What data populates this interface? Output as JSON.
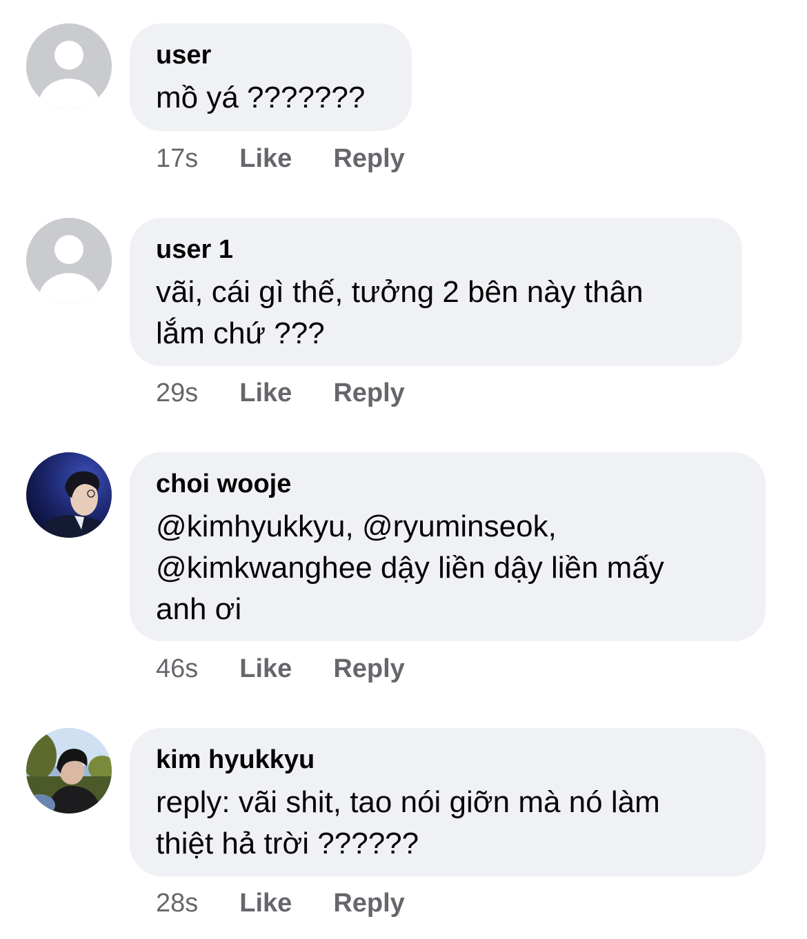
{
  "comments": [
    {
      "author": "user",
      "lines": [
        "mồ yá ???????"
      ],
      "time": "17s",
      "like": "Like",
      "reply": "Reply",
      "avatar": "default-avatar-icon"
    },
    {
      "author": "user 1",
      "lines": [
        "vãi, cái gì thế, tưởng 2 bên này thân",
        "lắm chứ ???"
      ],
      "time": "29s",
      "like": "Like",
      "reply": "Reply",
      "avatar": "default-avatar-icon"
    },
    {
      "author": "choi wooje",
      "lines": [
        "@kimhyukkyu, @ryuminseok,",
        "@kimkwanghee dậy liền dậy liền mấy",
        "anh ơi"
      ],
      "time": "46s",
      "like": "Like",
      "reply": "Reply",
      "avatar": "photo-avatar"
    },
    {
      "author": "kim hyukkyu",
      "lines": [
        "reply: vãi shit, tao nói giỡn mà nó làm",
        "thiệt hả trời ??????"
      ],
      "time": "28s",
      "like": "Like",
      "reply": "Reply",
      "avatar": "photo-avatar"
    }
  ],
  "colors": {
    "bubble": "#f0f1f5",
    "text": "#050505",
    "secondary": "#65676b",
    "default_avatar_bg": "#d0d2d6"
  }
}
